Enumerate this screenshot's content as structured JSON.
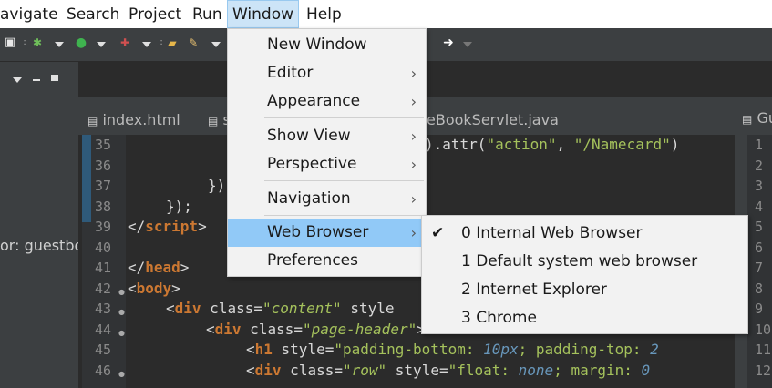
{
  "menubar": {
    "items": [
      "avigate",
      "Search",
      "Project",
      "Run",
      "Window",
      "Help"
    ]
  },
  "editor": {
    "tabs": [
      {
        "label": "index.html"
      },
      {
        "label": "s"
      },
      {
        "label": "eBookServlet.java"
      }
    ],
    "right_tab_label": "Gu",
    "left_pane_text": "or: guestbo",
    "line_numbers": [
      "35",
      "36",
      "37",
      "38",
      "39",
      "40",
      "41",
      "42",
      "43",
      "44",
      "45",
      "46"
    ],
    "code_fragments": {
      "l35": ").attr(",
      "l35_s1": "\"action\"",
      "l35_mid": ", ",
      "l35_s2": "\"/Namecard\"",
      "l35_end": ")",
      "l37": "})",
      "l38": "});",
      "l39_open": "</",
      "l39_tag": "script",
      "l39_close": ">",
      "l41_open": "</",
      "l41_tag": "head",
      "l41_close": ">",
      "l42_open": "<",
      "l42_tag": "body",
      "l42_close": ">",
      "l43_open": "<",
      "l43_tag": "div",
      "l43_attr": " class=",
      "l43_val": "\"content\"",
      "l43_rest": " style",
      "l44_open": "<",
      "l44_tag": "div",
      "l44_attr": " class=",
      "l44_val": "\"page-header\"",
      "l44_rest": ">",
      "l45_open": "<",
      "l45_tag": "h1",
      "l45_attr": " style=",
      "l45_val1": "\"padding-bottom: ",
      "l45_num1": "10px",
      "l45_val2": "; padding-top: ",
      "l45_num2": "2",
      "l46_open": "<",
      "l46_tag": "div",
      "l46_attr": " class=",
      "l46_val": "\"row\"",
      "l46_attr2": " style=",
      "l46_val2": "\"float: ",
      "l46_num": "none",
      "l46_val3": "; margin: ",
      "l46_num2": "0"
    },
    "right_line_numbers": [
      "1",
      "2",
      "3",
      "4",
      "5",
      "6",
      "7",
      "8",
      "9",
      "10",
      "11",
      "12"
    ]
  },
  "window_menu": {
    "items": [
      {
        "label": "New Window",
        "submenu": false
      },
      {
        "label": "Editor",
        "submenu": true
      },
      {
        "label": "Appearance",
        "submenu": true
      },
      {
        "label": "Show View",
        "submenu": true
      },
      {
        "label": "Perspective",
        "submenu": true
      },
      {
        "label": "Navigation",
        "submenu": true
      },
      {
        "label": "Web Browser",
        "submenu": true
      },
      {
        "label": "Preferences",
        "submenu": false
      }
    ],
    "chevron": "›"
  },
  "web_browser_submenu": {
    "items": [
      {
        "label": "0 Internal Web Browser",
        "checked": true
      },
      {
        "label": "1 Default system web browser",
        "checked": false
      },
      {
        "label": "2 Internet Explorer",
        "checked": false
      },
      {
        "label": "3 Chrome",
        "checked": false
      }
    ],
    "check_mark": "✔"
  },
  "colors": {
    "menu_highlight": "#91c9f7",
    "active_menubar": "#cce4f7",
    "editor_bg": "#2b2b2b"
  }
}
